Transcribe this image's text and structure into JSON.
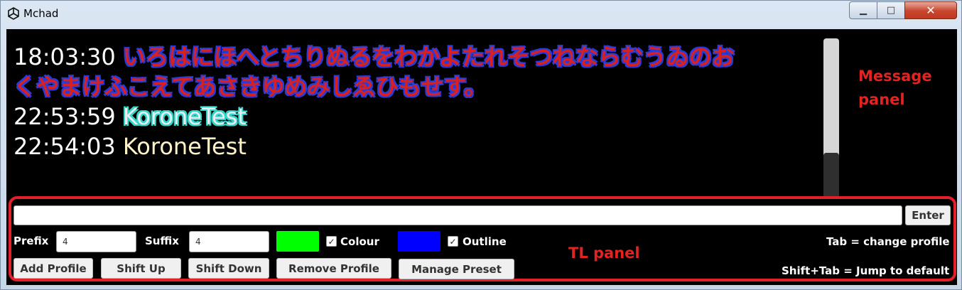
{
  "window": {
    "title": "Mchad",
    "controls": {
      "minimize": "▁",
      "maximize": "□",
      "close": "✕"
    }
  },
  "messages": [
    {
      "time": "18:03:30",
      "text_line1": "いろはにほへとちりぬるをわかよたれそつねならむうゐのお",
      "text_line2": "くやまけふこえてあさきゆめみしゑひもせす。",
      "style": "red-outline-blue"
    },
    {
      "time": "22:53:59",
      "text": "KoroneTest",
      "style": "light-outline-cyan"
    },
    {
      "time": "22:54:03",
      "text": "KoroneTest",
      "style": "cream"
    }
  ],
  "annotations": {
    "message_panel": "Message\npanel",
    "tl_panel": "TL panel"
  },
  "tl": {
    "input_value": "",
    "enter_label": "Enter",
    "prefix_label": "Prefix",
    "prefix_value": "4",
    "suffix_label": "Suffix",
    "suffix_value": "4",
    "colour_label": "Colour",
    "colour_checked": true,
    "colour_swatch": "#00ff00",
    "outline_label": "Outline",
    "outline_checked": true,
    "outline_swatch": "#0000ff",
    "buttons": {
      "add_profile": "Add Profile",
      "shift_up": "Shift Up",
      "shift_down": "Shift Down",
      "remove_profile": "Remove Profile",
      "manage_preset": "Manage Preset"
    },
    "hint_tab": "Tab = change profile",
    "hint_shift_tab": "Shift+Tab = Jump to default"
  }
}
